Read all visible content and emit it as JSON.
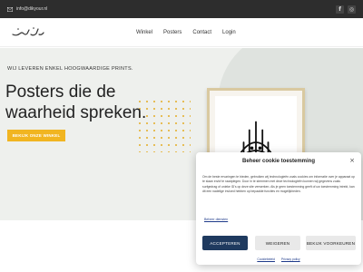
{
  "topbar": {
    "email": "info@dikyour.nl",
    "socials": [
      {
        "icon": "facebook-icon",
        "glyph": "f"
      },
      {
        "icon": "instagram-icon",
        "glyph": "◎"
      }
    ]
  },
  "header": {
    "logo_text": "دیکور",
    "nav": [
      "Winkel",
      "Posters",
      "Contact",
      "Login"
    ]
  },
  "hero": {
    "kicker": "WIJ LEVEREN ENKEL HOOGWAARDIGE PRINTS.",
    "headline": "Posters die de waarheid spreken.",
    "cta": "BEKIJK ONZE WINKEL",
    "accent_color": "#f1b521"
  },
  "cookie": {
    "title": "Beheer cookie toestemming",
    "close_glyph": "×",
    "body": "Om de beste ervaringen te bieden, gebruiken wij technologieën zoals cookies om informatie over je apparaat op te slaan en/of te raadplegen. Door in te stemmen met deze technologieën kunnen wij gegevens zoals surfgedrag of unieke ID's op deze site verwerken. Als je geen toestemming geeft of uw toestemming intrekt, kan dit een nadelige invloed hebben op bepaalde functies en mogelijkheden.",
    "manage_link": "Beheer diensten",
    "accept": "ACCEPTEREN",
    "decline": "WEIGEREN",
    "preferences": "BEKIJK VOORKEUREN",
    "footer_links": [
      "Cookiebeleid",
      "Privacy policy"
    ],
    "accept_color": "#1f3a5f"
  }
}
